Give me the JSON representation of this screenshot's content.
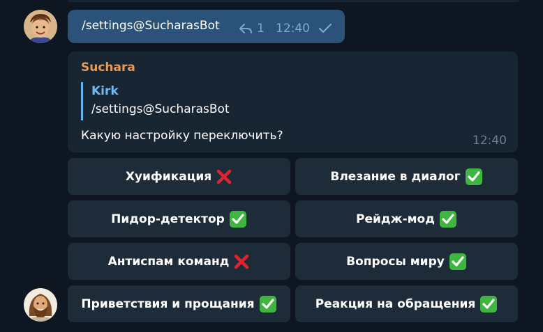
{
  "outgoing": {
    "text": "/settings@SucharasBot",
    "reply_count": "1",
    "time": "12:40"
  },
  "incoming": {
    "sender": "Suchara",
    "quote_name": "Kirk",
    "quote_text": "/settings@SucharasBot",
    "text": "Какую настройку переключить?",
    "time": "12:40"
  },
  "keyboard": [
    {
      "label": "Хуификация",
      "state": "off",
      "icon": "cross-mark-icon"
    },
    {
      "label": "Влезание в диалог",
      "state": "on",
      "icon": "check-mark-icon"
    },
    {
      "label": "Пидор-детектор",
      "state": "on",
      "icon": "check-mark-icon"
    },
    {
      "label": "Рейдж-мод",
      "state": "on",
      "icon": "check-mark-icon"
    },
    {
      "label": "Антиспам команд",
      "state": "off",
      "icon": "cross-mark-icon"
    },
    {
      "label": "Вопросы миру",
      "state": "on",
      "icon": "check-mark-icon"
    },
    {
      "label": "Приветствия и прощания",
      "state": "on",
      "icon": "check-mark-icon"
    },
    {
      "label": "Реакция на обращения",
      "state": "on",
      "icon": "check-mark-icon"
    }
  ],
  "colors": {
    "background": "#0e1621",
    "outgoing_bubble": "#2b5278",
    "incoming_bubble": "#182533",
    "keyboard_button": "#1e2c3a",
    "sender_name": "#e79b57",
    "quote_accent": "#64b5ef",
    "check_green": "#3fb63f",
    "cross_red": "#e0242f"
  }
}
